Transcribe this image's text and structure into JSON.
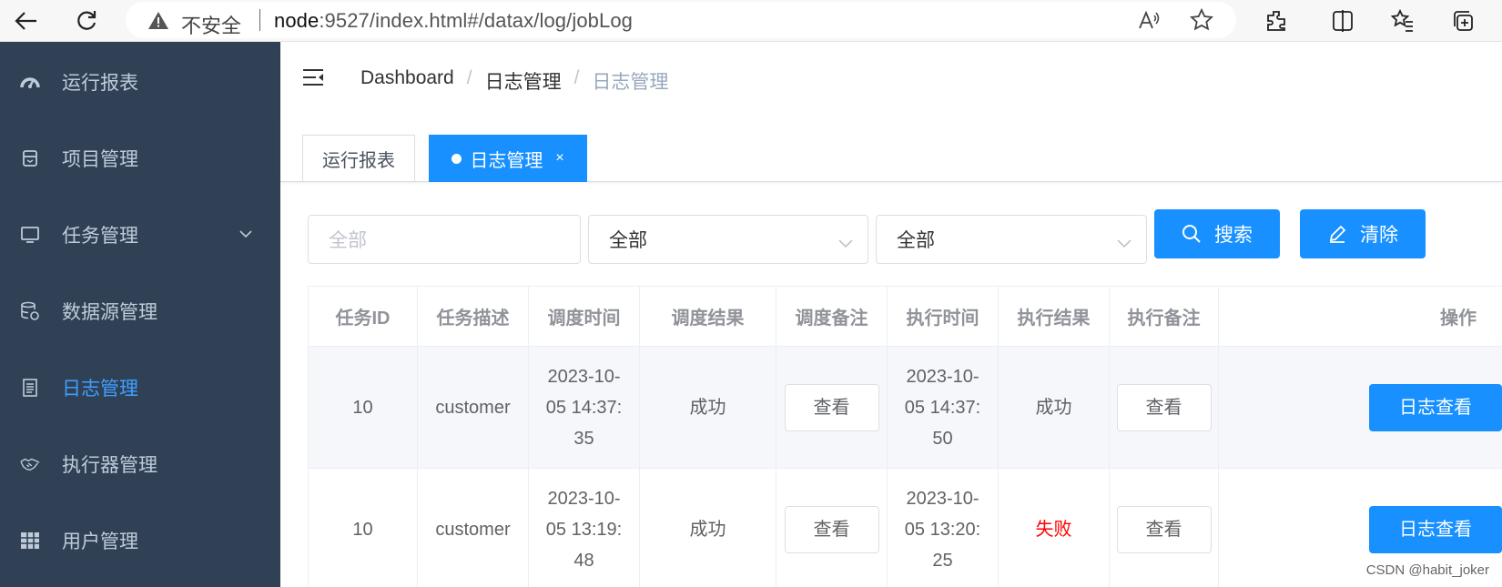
{
  "browser": {
    "insecure_label": "不安全",
    "url_host": "node",
    "url_rest": ":9527/index.html#/datax/log/jobLog"
  },
  "sidebar": {
    "items": [
      {
        "label": "运行报表",
        "icon": "dashboard-icon"
      },
      {
        "label": "项目管理",
        "icon": "project-icon"
      },
      {
        "label": "任务管理",
        "icon": "monitor-icon"
      },
      {
        "label": "数据源管理",
        "icon": "database-icon"
      },
      {
        "label": "日志管理",
        "icon": "document-icon"
      },
      {
        "label": "执行器管理",
        "icon": "handshake-icon"
      },
      {
        "label": "用户管理",
        "icon": "table-icon"
      }
    ]
  },
  "breadcrumb": {
    "items": [
      "Dashboard",
      "日志管理",
      "日志管理"
    ],
    "separator": "/"
  },
  "tags": [
    {
      "label": "运行报表"
    },
    {
      "label": "日志管理",
      "close": "×"
    }
  ],
  "filters": {
    "input_placeholder": "全部",
    "select1_value": "全部",
    "select2_value": "全部",
    "search_label": "搜索",
    "clear_label": "清除"
  },
  "table": {
    "headers": [
      "任务ID",
      "任务描述",
      "调度时间",
      "调度结果",
      "调度备注",
      "执行时间",
      "执行结果",
      "执行备注",
      "操作"
    ],
    "rows": [
      {
        "id": "10",
        "desc": "customer",
        "trigger_time": [
          "2023-10-",
          "05 14:37:",
          "35"
        ],
        "trigger_result": "成功",
        "trigger_note": "查看",
        "handle_time": [
          "2023-10-",
          "05 14:37:",
          "50"
        ],
        "handle_result": "成功",
        "handle_note": "查看",
        "action": "日志查看"
      },
      {
        "id": "10",
        "desc": "customer",
        "trigger_time": [
          "2023-10-",
          "05 13:19:",
          "48"
        ],
        "trigger_result": "成功",
        "trigger_note": "查看",
        "handle_time": [
          "2023-10-",
          "05 13:20:",
          "25"
        ],
        "handle_result": "失败",
        "handle_note": "查看",
        "action": "日志查看"
      }
    ]
  },
  "watermark": "CSDN @habit_joker",
  "colors": {
    "sidebar_bg": "#304156",
    "primary": "#1890ff",
    "active_menu": "#409eff",
    "fail": "#ff0000"
  }
}
